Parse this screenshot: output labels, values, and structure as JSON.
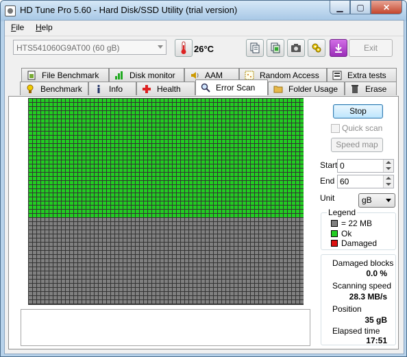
{
  "window": {
    "title": "HD Tune Pro 5.60 - Hard Disk/SSD Utility (trial version)"
  },
  "menu": {
    "file": "File",
    "help": "Help"
  },
  "toolbar": {
    "drive": "HTS541060G9AT00 (60 gB)",
    "temperature": "26°C",
    "exit_label": "Exit",
    "icons": [
      "copy-text-icon",
      "copy-screen-icon",
      "camera-icon",
      "options-icon",
      "save-icon"
    ]
  },
  "tabs_top": [
    {
      "label": "File Benchmark",
      "icon": "file-benchmark-icon"
    },
    {
      "label": "Disk monitor",
      "icon": "disk-monitor-icon"
    },
    {
      "label": "AAM",
      "icon": "speaker-icon"
    },
    {
      "label": "Random Access",
      "icon": "random-access-icon"
    },
    {
      "label": "Extra tests",
      "icon": "extra-tests-icon"
    }
  ],
  "tabs_bottom": [
    {
      "label": "Benchmark",
      "icon": "benchmark-icon"
    },
    {
      "label": "Info",
      "icon": "info-icon"
    },
    {
      "label": "Health",
      "icon": "health-cross-icon"
    },
    {
      "label": "Error Scan",
      "icon": "magnifier-icon",
      "active": true
    },
    {
      "label": "Folder Usage",
      "icon": "folder-icon"
    },
    {
      "label": "Erase",
      "icon": "trash-icon"
    }
  ],
  "scan": {
    "stop_label": "Stop",
    "quick_scan_label": "Quick scan",
    "quick_scan_checked": false,
    "speed_map_label": "Speed map",
    "start_label": "Start",
    "start_value": "0",
    "end_label": "End",
    "end_value": "60",
    "unit_label": "Unit",
    "unit_value": "gB",
    "progress_fraction": 0.58
  },
  "legend": {
    "title": "Legend",
    "block_size": "= 22 MB",
    "ok": "Ok",
    "damaged": "Damaged",
    "colors": {
      "unscanned": "#808080",
      "ok": "#22cc22",
      "damaged": "#dd1111"
    }
  },
  "stats": {
    "damaged_label": "Damaged blocks",
    "damaged_value": "0.0 %",
    "speed_label": "Scanning speed",
    "speed_value": "28.3 MB/s",
    "position_label": "Position",
    "position_value": "35 gB",
    "elapsed_label": "Elapsed time",
    "elapsed_value": "17:51"
  },
  "log": {
    "text": ""
  }
}
